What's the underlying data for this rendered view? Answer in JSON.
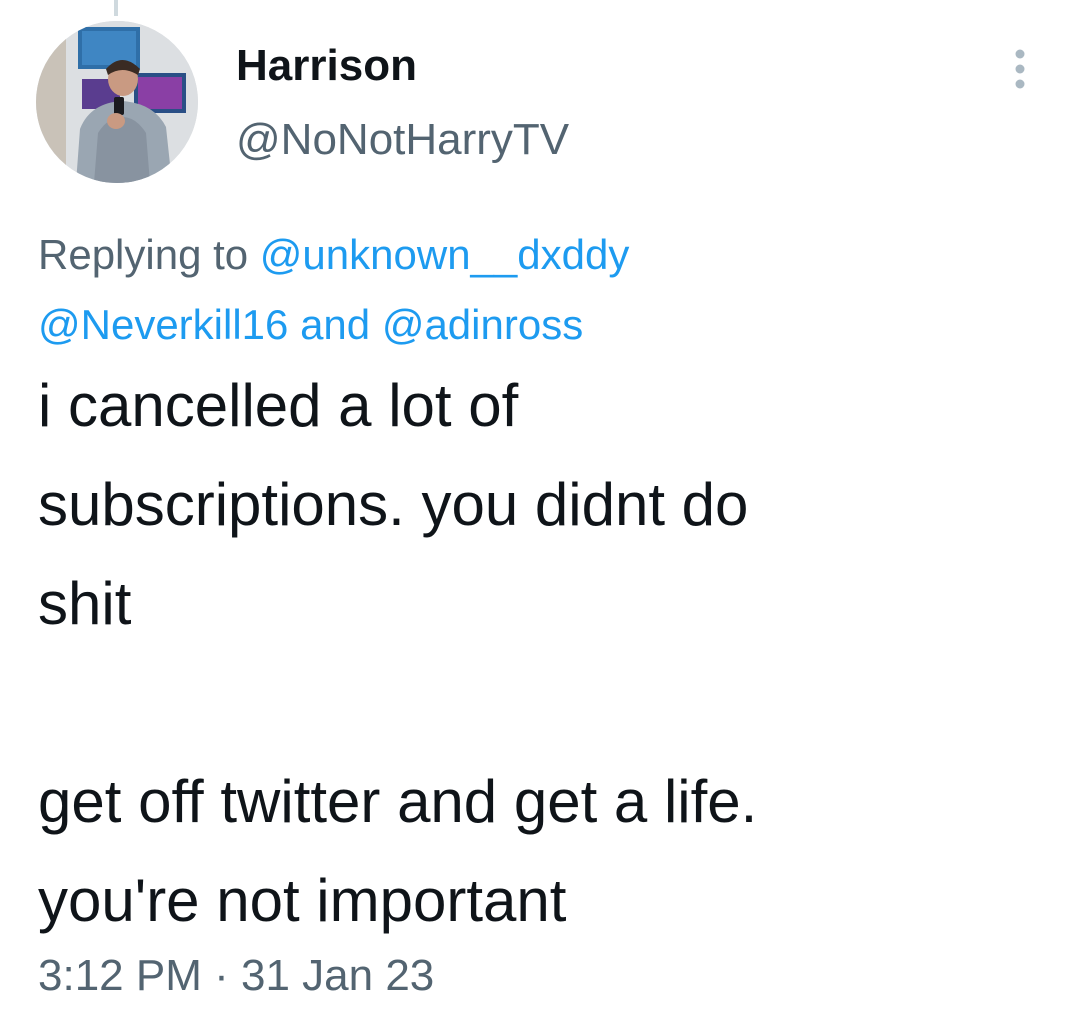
{
  "tweet": {
    "author_name": "Harrison",
    "author_handle": "@NoNotHarryTV",
    "avatar_icon": "profile-photo",
    "menu_icon": "more-vertical-icon",
    "replying_to": {
      "prefix": "Replying to",
      "handle_1": "@unknown__dxddy",
      "handle_2": "@Neverkill16",
      "connector": "and",
      "handle_3": "@adinross"
    },
    "text_lines": [
      "i cancelled a lot of",
      "subscriptions. you didnt do",
      "shit",
      "get off twitter and get a life.",
      "you're not important"
    ],
    "time": "3:12 PM",
    "separator": "·",
    "date": "31 Jan 23"
  },
  "colors": {
    "text_primary": "#0f1419",
    "text_secondary": "#536471",
    "link": "#1d9bf0"
  }
}
